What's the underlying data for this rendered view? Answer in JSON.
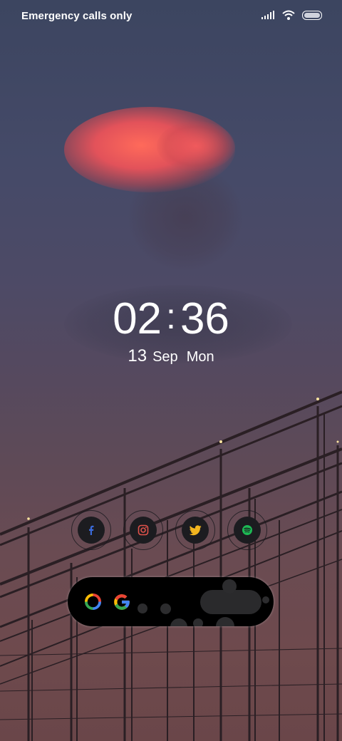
{
  "status_bar": {
    "carrier_text": "Emergency calls only",
    "icons": [
      "signal-icon",
      "wifi-icon",
      "battery-icon"
    ]
  },
  "clock": {
    "hours": "02",
    "separator": ":",
    "minutes": "36"
  },
  "date": {
    "day": "13",
    "month": "Sep",
    "weekday": "Mon"
  },
  "social_shortcuts": [
    {
      "name": "facebook-icon",
      "color": "#3b6ad9"
    },
    {
      "name": "instagram-icon",
      "color": "#e0524b"
    },
    {
      "name": "twitter-icon",
      "color": "#f2b51f"
    },
    {
      "name": "spotify-icon",
      "color": "#1db954"
    }
  ],
  "search_widget": {
    "icons": [
      "google-lens-icon",
      "google-g-icon"
    ]
  },
  "colors": {
    "lens_red": "#ea4335",
    "lens_yellow": "#fbbc05",
    "lens_green": "#34a853",
    "lens_blue": "#4285f4"
  }
}
